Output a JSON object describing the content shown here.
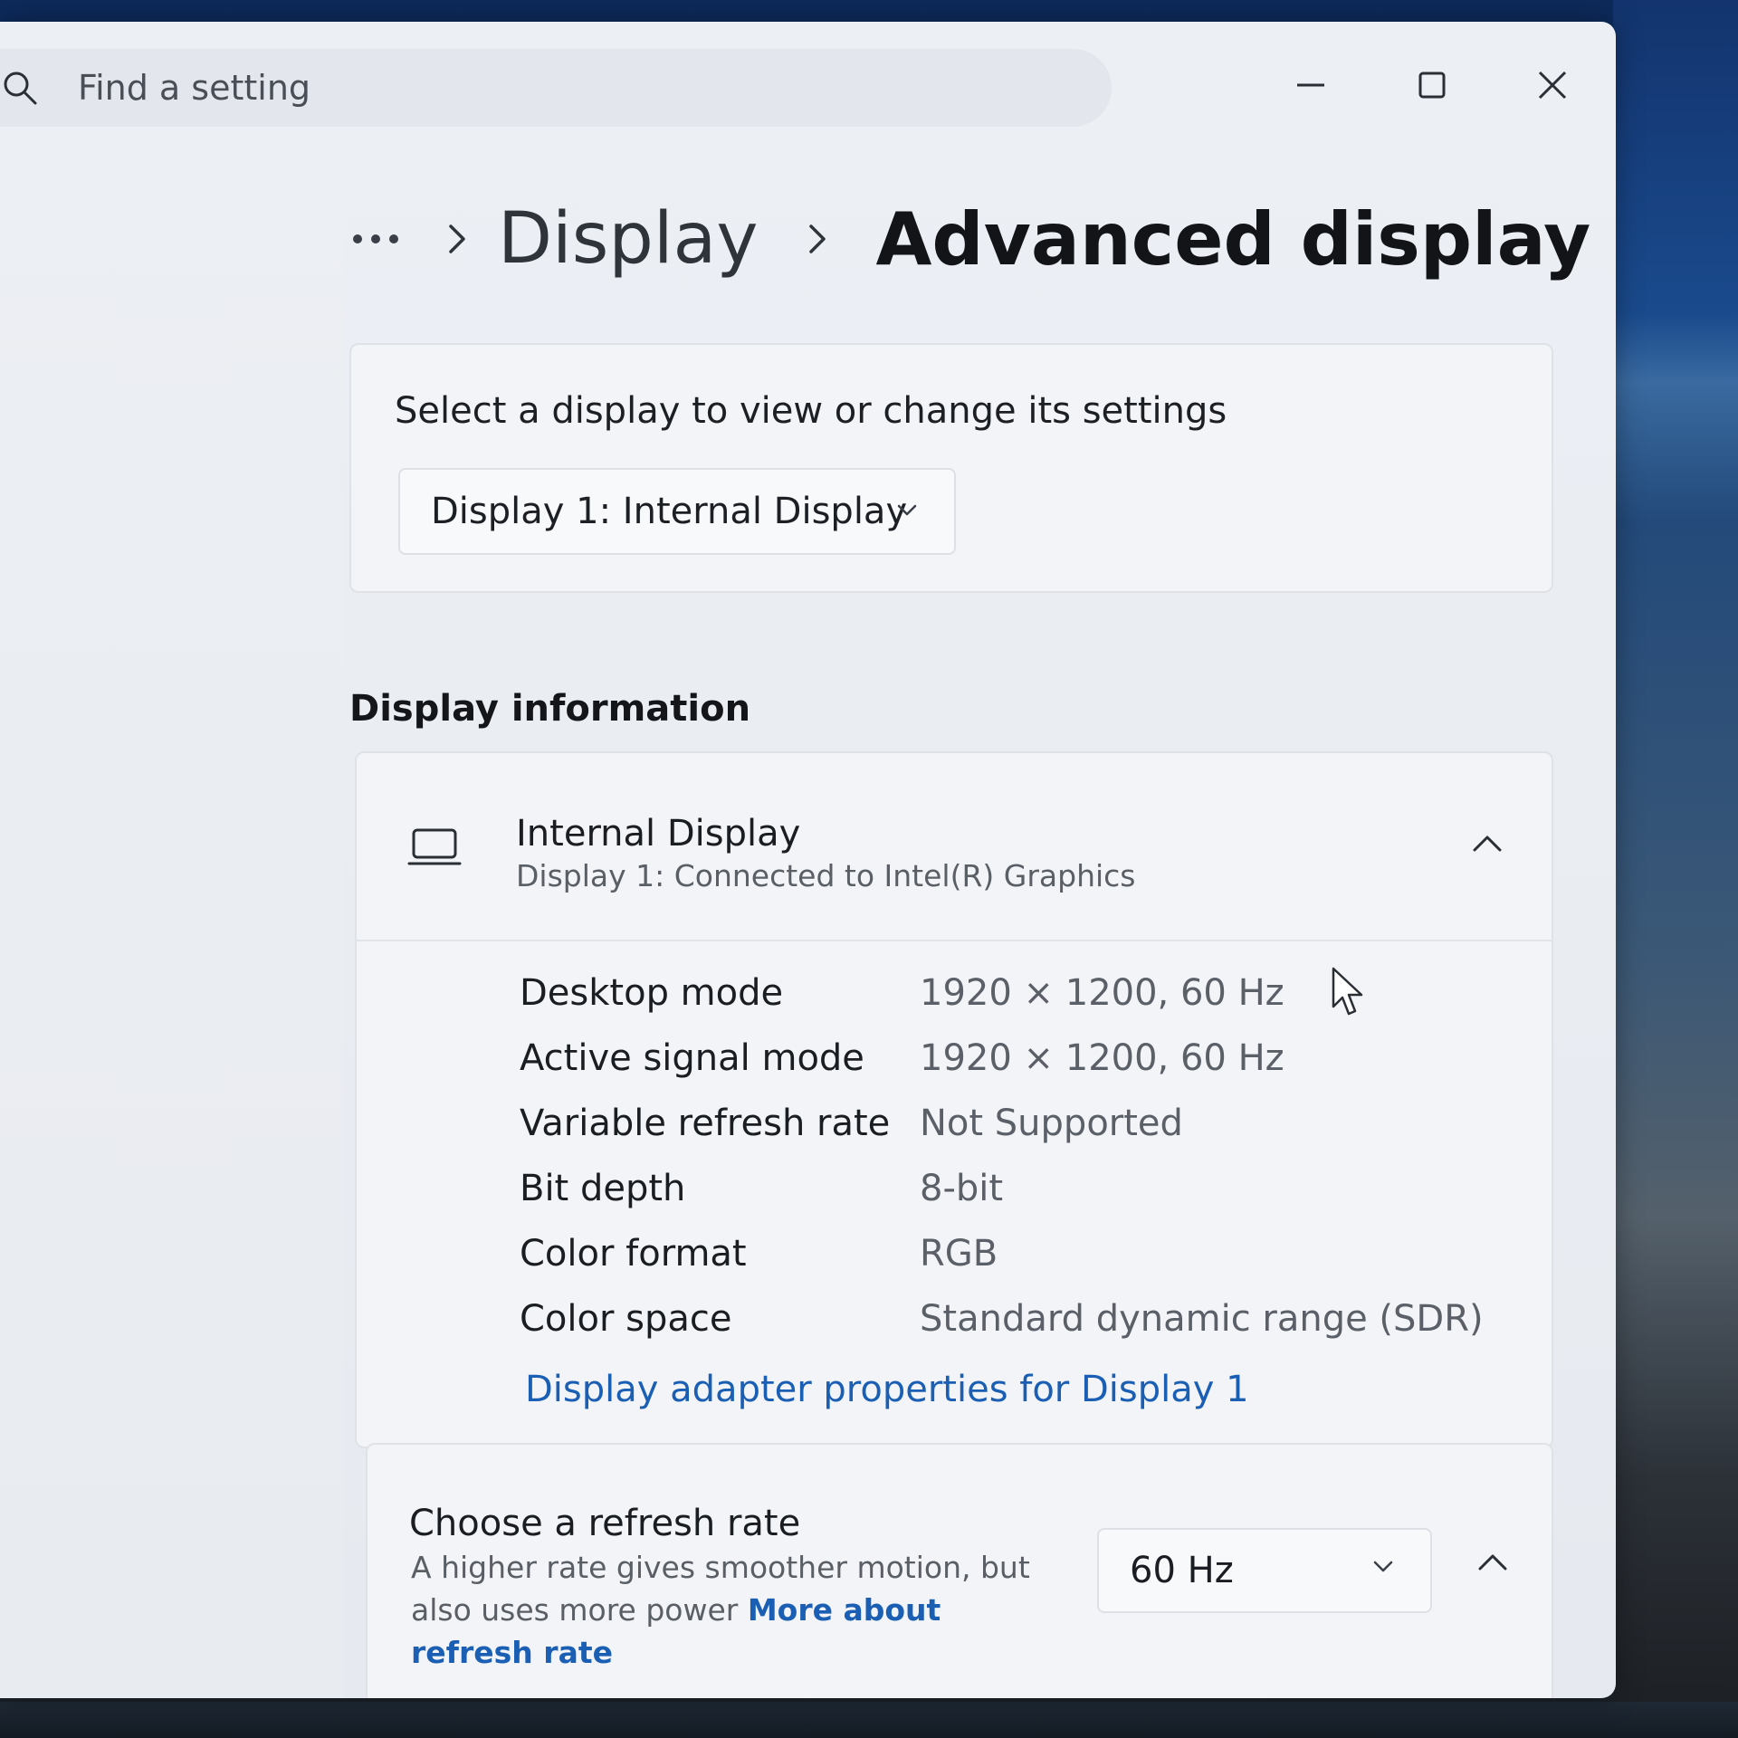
{
  "search": {
    "placeholder": "Find a setting"
  },
  "breadcrumb": {
    "parent": "Display",
    "current": "Advanced display"
  },
  "display_select": {
    "prompt": "Select a display to view or change its settings",
    "selected": "Display 1: Internal Display"
  },
  "display_info": {
    "section_title": "Display information",
    "name": "Internal Display",
    "subtitle": "Display 1: Connected to Intel(R) Graphics",
    "specs": [
      {
        "label": "Desktop mode",
        "value": "1920 × 1200, 60 Hz"
      },
      {
        "label": "Active signal mode",
        "value": "1920 × 1200, 60 Hz"
      },
      {
        "label": "Variable refresh rate",
        "value": "Not Supported"
      },
      {
        "label": "Bit depth",
        "value": "8-bit"
      },
      {
        "label": "Color format",
        "value": "RGB"
      },
      {
        "label": "Color space",
        "value": "Standard dynamic range (SDR)"
      }
    ],
    "adapter_link": "Display adapter properties for Display 1"
  },
  "refresh_rate": {
    "title": "Choose a refresh rate",
    "description": "A higher rate gives smoother motion, but also uses more power",
    "link": "More about refresh rate",
    "selected": "60 Hz"
  },
  "icons": {
    "search": "search-icon",
    "minimize": "minimize-icon",
    "maximize": "maximize-icon",
    "close": "close-icon",
    "laptop": "laptop-icon",
    "chevron_down": "chevron-down-icon",
    "chevron_up": "chevron-up-icon",
    "chevron_right": "chevron-right-icon"
  },
  "colors": {
    "accent_link": "#1a5fb4"
  }
}
